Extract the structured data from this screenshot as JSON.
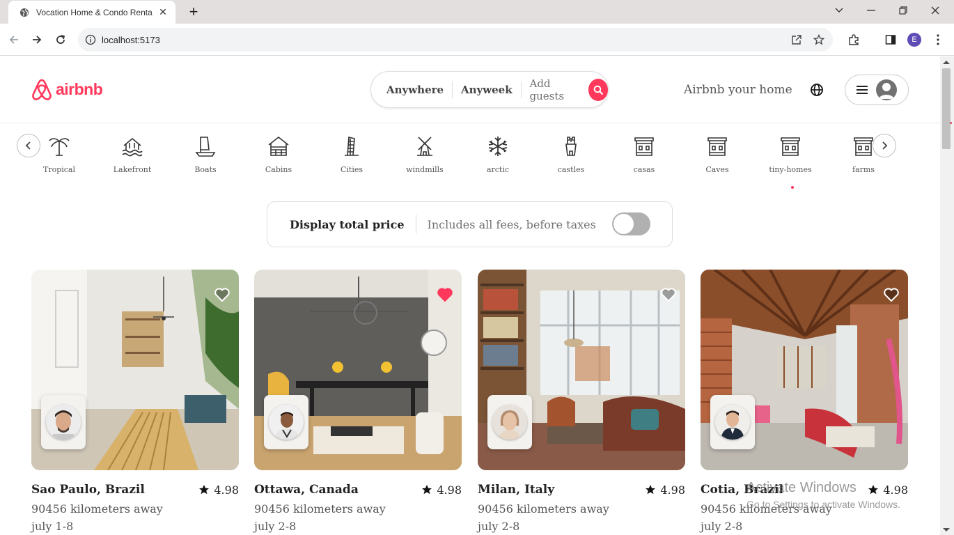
{
  "browser": {
    "tab_title": "Vocation Home & Condo Renta",
    "url": "localhost:5173",
    "profile_initial": "E"
  },
  "header": {
    "logo_text": "airbnb",
    "search": {
      "anywhere": "Anywhere",
      "anyweek": "Anyweek",
      "guests": "Add guests"
    },
    "host_link": "Airbnb your home"
  },
  "categories": [
    {
      "label": "Tropical",
      "icon": "palm-tree-icon"
    },
    {
      "label": "Lakefront",
      "icon": "lakefront-icon"
    },
    {
      "label": "Boats",
      "icon": "boat-icon"
    },
    {
      "label": "Cabins",
      "icon": "cabin-icon"
    },
    {
      "label": "Cities",
      "icon": "city-tower-icon"
    },
    {
      "label": "windmills",
      "icon": "windmill-icon"
    },
    {
      "label": "arctic",
      "icon": "snowflake-icon"
    },
    {
      "label": "castles",
      "icon": "castle-icon"
    },
    {
      "label": "casas",
      "icon": "house-icon"
    },
    {
      "label": "Caves",
      "icon": "house-icon"
    },
    {
      "label": "tiny-homes",
      "icon": "house-icon"
    },
    {
      "label": "farms",
      "icon": "house-icon"
    }
  ],
  "price_toggle": {
    "label": "Display total price",
    "description": "Includes all fees, before taxes",
    "enabled": false
  },
  "listings": [
    {
      "location": "Sao Paulo, Brazil",
      "rating": "4.98",
      "distance": "90456 kilometers away",
      "dates": "july 1-8",
      "favorited": false
    },
    {
      "location": "Ottawa, Canada",
      "rating": "4.98",
      "distance": "90456 kilometers away",
      "dates": "july 2-8",
      "favorited": true
    },
    {
      "location": "Milan, Italy",
      "rating": "4.98",
      "distance": "90456 kilometers away",
      "dates": "july 2-8",
      "favorited": false
    },
    {
      "location": "Cotia, Brazil",
      "rating": "4.98",
      "distance": "90456 kilometers away",
      "dates": "july 2-8",
      "favorited": false
    }
  ],
  "watermark": {
    "title": "Activate Windows",
    "subtitle": "Go to Settings to activate Windows."
  },
  "colors": {
    "brand": "#ff385c",
    "text": "#222222",
    "muted": "#717171"
  }
}
